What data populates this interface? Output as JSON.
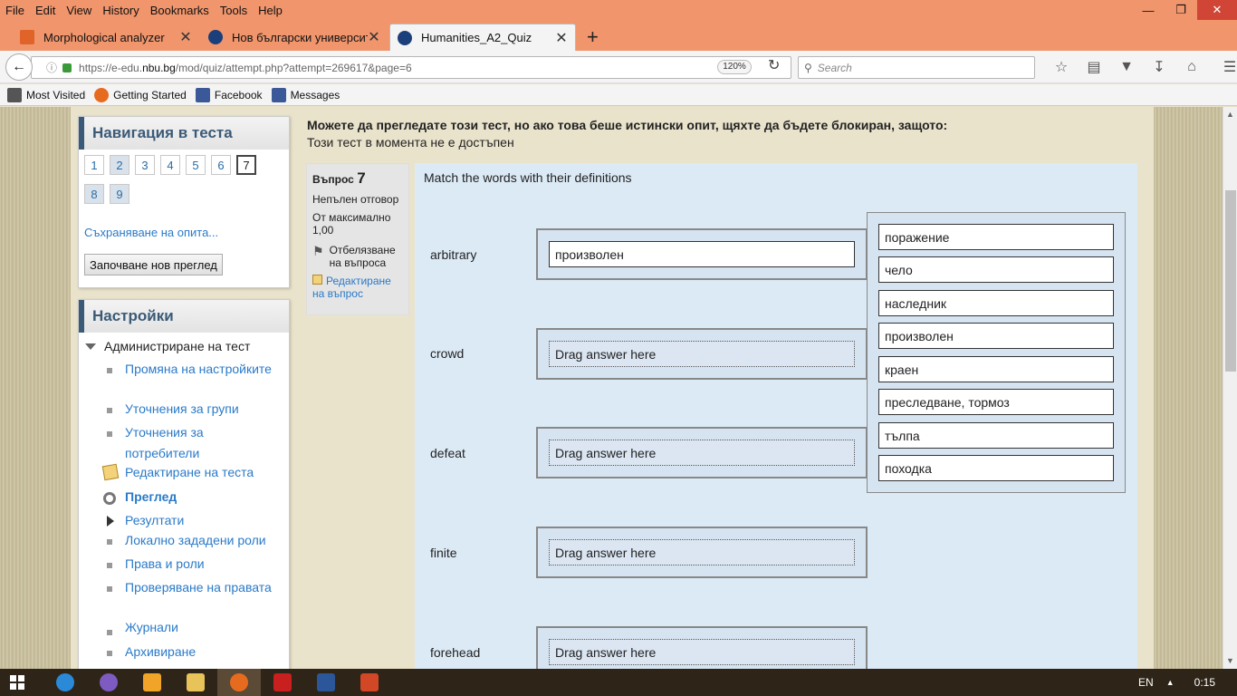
{
  "menubar": {
    "items": [
      "File",
      "Edit",
      "View",
      "History",
      "Bookmarks",
      "Tools",
      "Help"
    ],
    "underline": [
      "F",
      "E",
      "V",
      "s",
      "B",
      "T",
      "H"
    ]
  },
  "tabs": [
    {
      "title": "Morphological analyzer",
      "color": "#e0632a"
    },
    {
      "title": "Нов български университ...",
      "color": "#1b3f7a"
    },
    {
      "title": "Humanities_A2_Quiz",
      "color": "#1b3f7a"
    }
  ],
  "nav": {
    "url_pre": "https://e-edu.",
    "url_host": "nbu.bg",
    "url_post": "/mod/quiz/attempt.php?attempt=269617&page=6",
    "zoom": "120%",
    "search_placeholder": "Search"
  },
  "bookmarks": [
    {
      "label": "Most Visited",
      "color": "#444"
    },
    {
      "label": "Getting Started",
      "color": "#e76b1e"
    },
    {
      "label": "Facebook",
      "color": "#3b5998"
    },
    {
      "label": "Messages",
      "color": "#3b5998"
    }
  ],
  "quiz_nav": {
    "title": "Навигация в теста",
    "questions": [
      "1",
      "2",
      "3",
      "4",
      "5",
      "6",
      "7",
      "8",
      "9"
    ],
    "save_link": "Съхраняване на опита...",
    "new_review": "Започване нов преглед"
  },
  "settings": {
    "title": "Настройки",
    "admin": "Администриране на тест",
    "items": [
      "Промяна на настройките",
      "Уточнения за групи",
      "Уточнения за потребители",
      "Редактиране на теста",
      "Преглед",
      "Резултати",
      "Локално зададени роли",
      "Права и роли",
      "Проверяване на правата",
      "Журнали",
      "Архивиране"
    ]
  },
  "warning": {
    "bold": "Можете да прегледате този тест, но ако това беше истински опит, щяхте да бъдете блокиран, защото:",
    "sub": "Този тест в момента не е достъпен"
  },
  "question_info": {
    "label": "Въпрос",
    "number": "7",
    "status": "Непълен отговор",
    "max_label": "От максимално",
    "max_value": "1,00",
    "flag": "Отбелязване на въпроса",
    "edit": "Редактиране на въпрос"
  },
  "question": {
    "prompt": "Match the words with their definitions",
    "stems": [
      "arbitrary",
      "crowd",
      "defeat",
      "finite",
      "forehead"
    ],
    "drops": [
      "произволен",
      "Drag answer here",
      "Drag answer here",
      "Drag answer here",
      "Drag answer here"
    ],
    "answers": [
      "поражение",
      "чело",
      "наследник",
      "произволен",
      "краен",
      "преследване, тормоз",
      "тълпа",
      "походка"
    ]
  },
  "taskbar": {
    "lang": "EN",
    "time": "0:15"
  }
}
